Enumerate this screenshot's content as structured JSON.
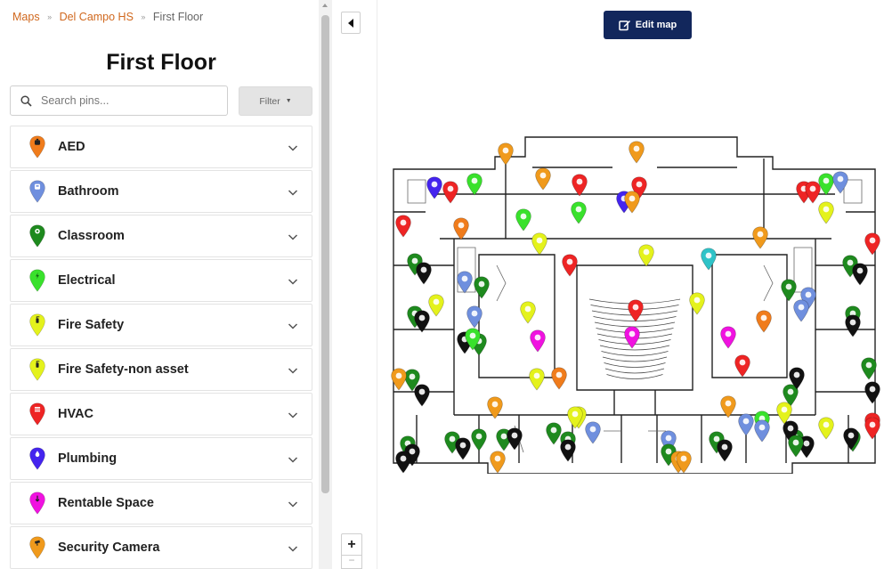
{
  "breadcrumb": {
    "items": [
      "Maps",
      "Del Campo HS"
    ],
    "current": "First Floor"
  },
  "page_title": "First Floor",
  "search": {
    "placeholder": "Search pins...",
    "value": ""
  },
  "filter_label": "Filter",
  "categories": [
    {
      "label": "AED",
      "color": "#f07c1c",
      "icon": "aed-icon"
    },
    {
      "label": "Bathroom",
      "color": "#6f8fde",
      "icon": "bathroom-icon"
    },
    {
      "label": "Classroom",
      "color": "#1e8a1e",
      "icon": "classroom-icon"
    },
    {
      "label": "Electrical",
      "color": "#39e12c",
      "icon": "electrical-icon"
    },
    {
      "label": "Fire Safety",
      "color": "#e4f21c",
      "icon": "fire-extinguisher-icon"
    },
    {
      "label": "Fire Safety-non asset",
      "color": "#e4f21c",
      "icon": "fire-extinguisher-icon"
    },
    {
      "label": "HVAC",
      "color": "#ee2424",
      "icon": "hvac-icon"
    },
    {
      "label": "Plumbing",
      "color": "#4424ee",
      "icon": "plumbing-icon"
    },
    {
      "label": "Rentable Space",
      "color": "#f012e0",
      "icon": "rentable-space-icon"
    },
    {
      "label": "Security Camera",
      "color": "#f09a1c",
      "icon": "security-camera-icon"
    }
  ],
  "edit_map_label": "Edit map",
  "zoom": {
    "in_label": "+",
    "out_label": "−"
  },
  "map_pins": [
    {
      "color": "#f09a1c"
    },
    {
      "color": "#f09a1c"
    },
    {
      "color": "#f09a1c"
    },
    {
      "color": "#4424ee"
    },
    {
      "color": "#ee2424"
    },
    {
      "color": "#39e12c"
    },
    {
      "color": "#ee2424"
    },
    {
      "color": "#4424ee"
    },
    {
      "color": "#ee2424"
    },
    {
      "color": "#ee2424"
    },
    {
      "color": "#ee2424"
    },
    {
      "color": "#39e12c"
    },
    {
      "color": "#6f8fde"
    },
    {
      "color": "#e4f21c"
    },
    {
      "color": "#ee2424"
    },
    {
      "color": "#f07c1c"
    },
    {
      "color": "#39e12c"
    },
    {
      "color": "#e4f21c"
    },
    {
      "color": "#39e12c"
    },
    {
      "color": "#f09a1c"
    },
    {
      "color": "#f09a1c"
    },
    {
      "color": "#ee2424"
    },
    {
      "color": "#e4f21c"
    },
    {
      "color": "#2fc3c8"
    },
    {
      "color": "#1e8a1e"
    },
    {
      "color": "#111111"
    },
    {
      "color": "#6f8fde"
    },
    {
      "color": "#1e8a1e"
    },
    {
      "color": "#e4f21c"
    },
    {
      "color": "#1e8a1e"
    },
    {
      "color": "#111111"
    },
    {
      "color": "#6f8fde"
    },
    {
      "color": "#111111"
    },
    {
      "color": "#1e8a1e"
    },
    {
      "color": "#e4f21c"
    },
    {
      "color": "#f012e0"
    },
    {
      "color": "#ee2424"
    },
    {
      "color": "#f012e0"
    },
    {
      "color": "#e4f21c"
    },
    {
      "color": "#f012e0"
    },
    {
      "color": "#f07c1c"
    },
    {
      "color": "#1e8a1e"
    },
    {
      "color": "#6f8fde"
    },
    {
      "color": "#6f8fde"
    },
    {
      "color": "#1e8a1e"
    },
    {
      "color": "#111111"
    },
    {
      "color": "#1e8a1e"
    },
    {
      "color": "#111111"
    },
    {
      "color": "#ee2424"
    },
    {
      "color": "#f07c1c"
    },
    {
      "color": "#1e8a1e"
    },
    {
      "color": "#111111"
    },
    {
      "color": "#f09a1c"
    },
    {
      "color": "#1e8a1e"
    },
    {
      "color": "#111111"
    },
    {
      "color": "#f09a1c"
    },
    {
      "color": "#e4f21c"
    },
    {
      "color": "#1e8a1e"
    },
    {
      "color": "#111111"
    },
    {
      "color": "#ee2424"
    },
    {
      "color": "#f09a1c"
    },
    {
      "color": "#e4f21c"
    },
    {
      "color": "#1e8a1e"
    },
    {
      "color": "#111111"
    },
    {
      "color": "#1e8a1e"
    },
    {
      "color": "#111111"
    },
    {
      "color": "#1e8a1e"
    },
    {
      "color": "#1e8a1e"
    },
    {
      "color": "#111111"
    },
    {
      "color": "#1e8a1e"
    },
    {
      "color": "#6f8fde"
    },
    {
      "color": "#1e8a1e"
    },
    {
      "color": "#111111"
    },
    {
      "color": "#6f8fde"
    },
    {
      "color": "#1e8a1e"
    },
    {
      "color": "#6f8fde"
    },
    {
      "color": "#39e12c"
    },
    {
      "color": "#1e8a1e"
    },
    {
      "color": "#111111"
    },
    {
      "color": "#e4f21c"
    },
    {
      "color": "#1e8a1e"
    },
    {
      "color": "#111111"
    },
    {
      "color": "#1e8a1e"
    },
    {
      "color": "#111111"
    },
    {
      "color": "#ee2424"
    },
    {
      "color": "#111111"
    },
    {
      "color": "#f09a1c"
    },
    {
      "color": "#f09a1c"
    },
    {
      "color": "#111111"
    },
    {
      "color": "#1e8a1e"
    },
    {
      "color": "#f09a1c"
    },
    {
      "color": "#ee2424"
    },
    {
      "color": "#e4f21c"
    },
    {
      "color": "#39e12c"
    },
    {
      "color": "#6f8fde"
    },
    {
      "color": "#e4f21c"
    }
  ]
}
